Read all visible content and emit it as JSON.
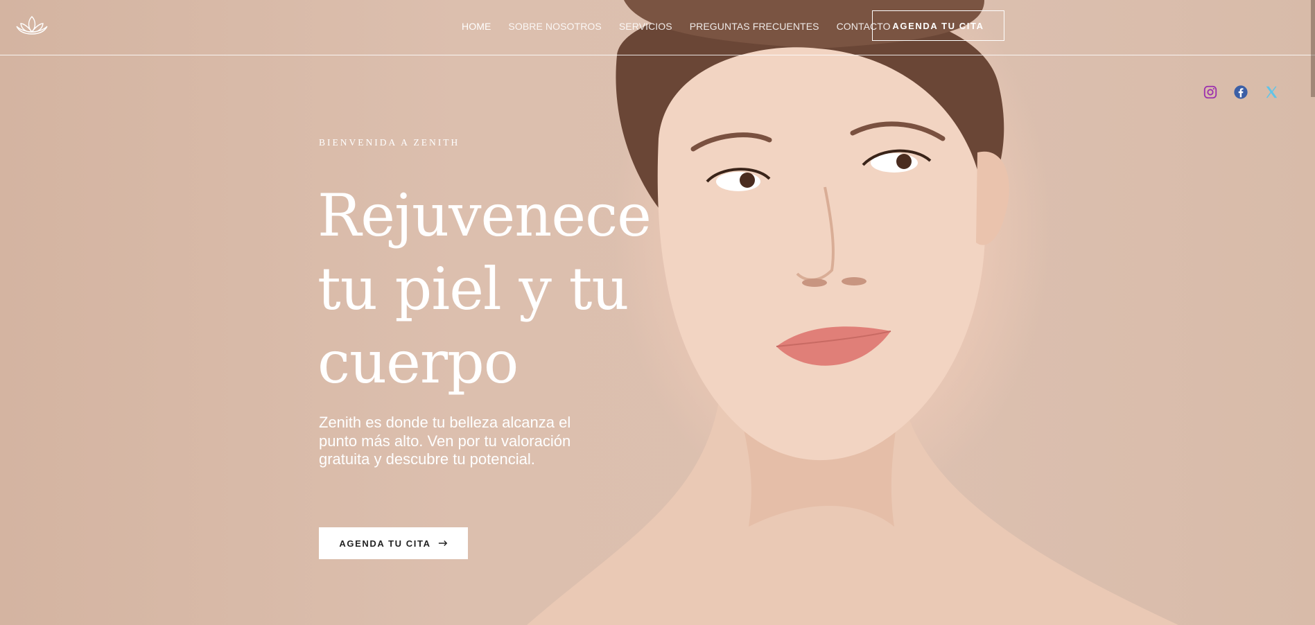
{
  "brand": {
    "logo_icon": "lotus-icon"
  },
  "nav": {
    "items": [
      {
        "label": "HOME",
        "active": true
      },
      {
        "label": "SOBRE NOSOTROS",
        "active": false
      },
      {
        "label": "SERVICIOS",
        "active": false
      },
      {
        "label": "PREGUNTAS FRECUENTES",
        "active": false
      },
      {
        "label": "CONTACTO",
        "active": false
      }
    ],
    "cta_label": "AGENDA TU CITA"
  },
  "socials": [
    {
      "icon": "instagram-icon",
      "color": "#9b2fae"
    },
    {
      "icon": "facebook-icon",
      "color": "#3b5fa6"
    },
    {
      "icon": "x-icon",
      "color": "#5fc4e8"
    }
  ],
  "hero": {
    "eyebrow": "BIENVENIDA A ZENITH",
    "headline_line1": "Rejuvenece",
    "headline_line2": "tu piel y tu",
    "headline_line3": "cuerpo",
    "lede": "Zenith es donde tu belleza alcanza el punto más alto. Ven por tu valoración gratuita y descubre tu potencial.",
    "cta_label": "AGENDA TU CITA",
    "cta_icon": "arrow-right-icon"
  }
}
